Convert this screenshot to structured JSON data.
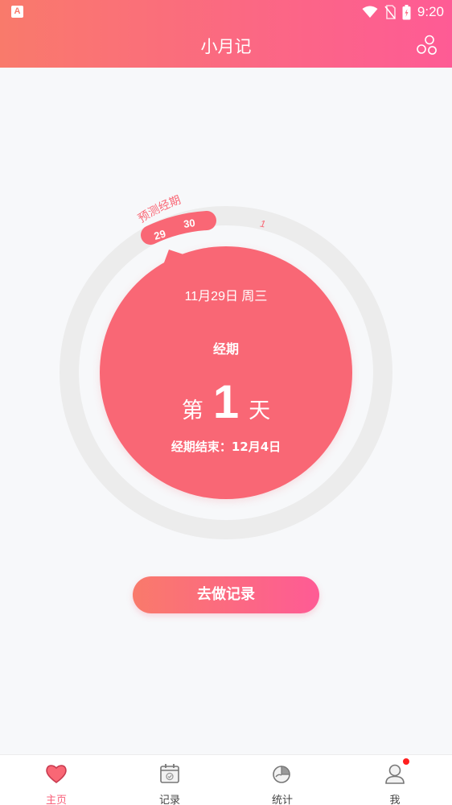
{
  "app": {
    "title": "小月记"
  },
  "status_bar": {
    "time": "9:20",
    "app_icon_letter": "A"
  },
  "ring": {
    "predicted_label": "预测经期",
    "predicted_days": [
      "29",
      "30"
    ],
    "next_day": "1"
  },
  "card": {
    "date": "11月29日 周三",
    "phase": "经期",
    "day_prefix": "第",
    "day_number": "1",
    "day_suffix": "天",
    "period_end": "经期结束：12月4日"
  },
  "actions": {
    "record_button": "去做记录"
  },
  "tabs": [
    {
      "label": "主页",
      "icon": "heart-icon",
      "active": true
    },
    {
      "label": "记录",
      "icon": "calendar-icon",
      "active": false
    },
    {
      "label": "统计",
      "icon": "pie-chart-icon",
      "active": false
    },
    {
      "label": "我",
      "icon": "user-icon",
      "active": false,
      "badge": true
    }
  ],
  "colors": {
    "accent": "#f96775",
    "gradient_start": "#f97a6b",
    "gradient_end": "#fe5b95",
    "ring_track": "#ececec"
  }
}
